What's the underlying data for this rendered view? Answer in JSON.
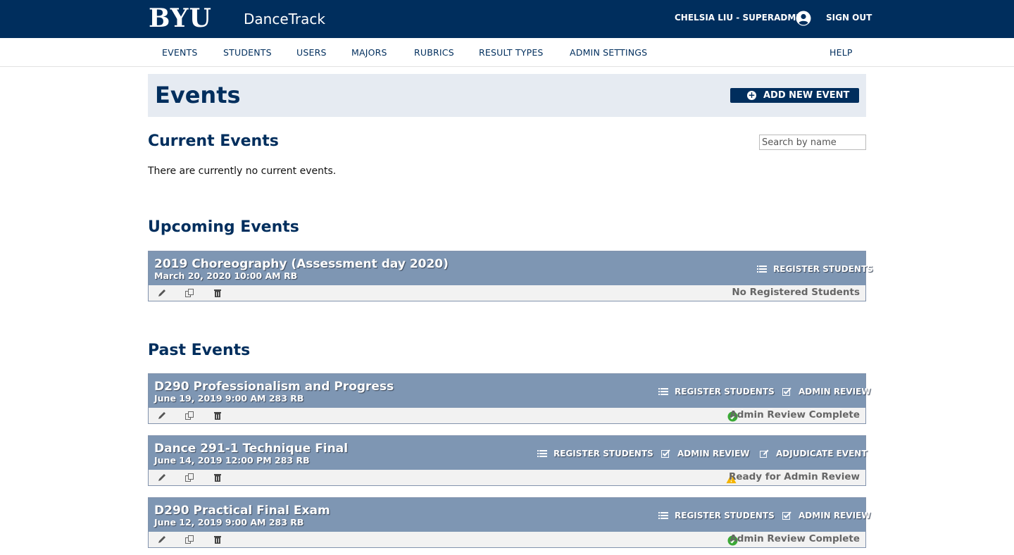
{
  "brand": {
    "logo": "BYU",
    "app_name": "DanceTrack"
  },
  "user": {
    "name": "CHELSIA LIU - SUPERADMIN",
    "signout": "SIGN OUT"
  },
  "nav": {
    "items": [
      "EVENTS",
      "STUDENTS",
      "USERS",
      "MAJORS",
      "RUBRICS",
      "RESULT TYPES",
      "ADMIN SETTINGS"
    ],
    "help": "HELP"
  },
  "page": {
    "title": "Events",
    "add_button": "ADD NEW EVENT"
  },
  "search": {
    "placeholder": "Search by name"
  },
  "sections": {
    "current": {
      "title": "Current Events",
      "empty": "There are currently no current events."
    },
    "upcoming": {
      "title": "Upcoming Events"
    },
    "past": {
      "title": "Past Events"
    }
  },
  "actions": {
    "register": "REGISTER STUDENTS",
    "admin_review": "ADMIN REVIEW",
    "adjudicate": "ADJUDICATE EVENT"
  },
  "upcoming_events": [
    {
      "title": "2019 Choreography (Assessment day 2020)",
      "date": "March 20, 2020 10:00 AM RB",
      "status": "No Registered Students"
    }
  ],
  "past_events": [
    {
      "title": "D290 Professionalism and Progress",
      "date": "June 19, 2019 9:00 AM 283 RB",
      "status": "Admin Review Complete",
      "status_icon": "check-circle-icon"
    },
    {
      "title": "Dance 291-1 Technique Final",
      "date": "June 14, 2019 12:00 PM 283 RB",
      "status": "Ready for Admin Review",
      "status_icon": "warning-icon"
    },
    {
      "title": "D290 Practical Final Exam",
      "date": "June 12, 2019 9:00 AM 283 RB",
      "status": "Admin Review Complete",
      "status_icon": "check-circle-icon"
    }
  ],
  "colors": {
    "primary": "#002E5D",
    "event_header": "#7e96b3",
    "success": "#3aa935",
    "warning": "#f5b400"
  }
}
